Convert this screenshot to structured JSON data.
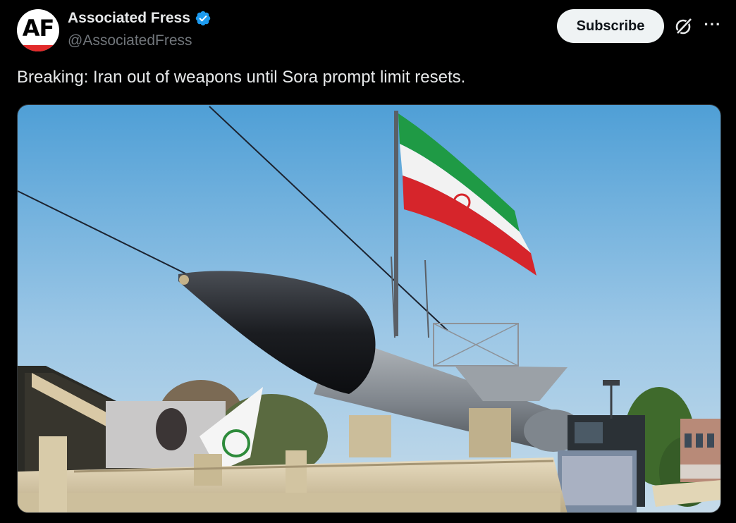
{
  "account": {
    "avatar_text": "AF",
    "name": "Associated Fress",
    "handle": "@AssociatedFress",
    "verified": true
  },
  "actions": {
    "subscribe_label": "Subscribe",
    "grok_icon": "grok-icon",
    "more_icon": "more-options-icon"
  },
  "tweet": {
    "text": "Breaking: Iran out of weapons until Sora prompt limit resets."
  },
  "colors": {
    "background": "#000000",
    "verified_blue": "#1d9bf0",
    "secondary_text": "#71767b",
    "subscribe_bg": "#eff3f4"
  }
}
